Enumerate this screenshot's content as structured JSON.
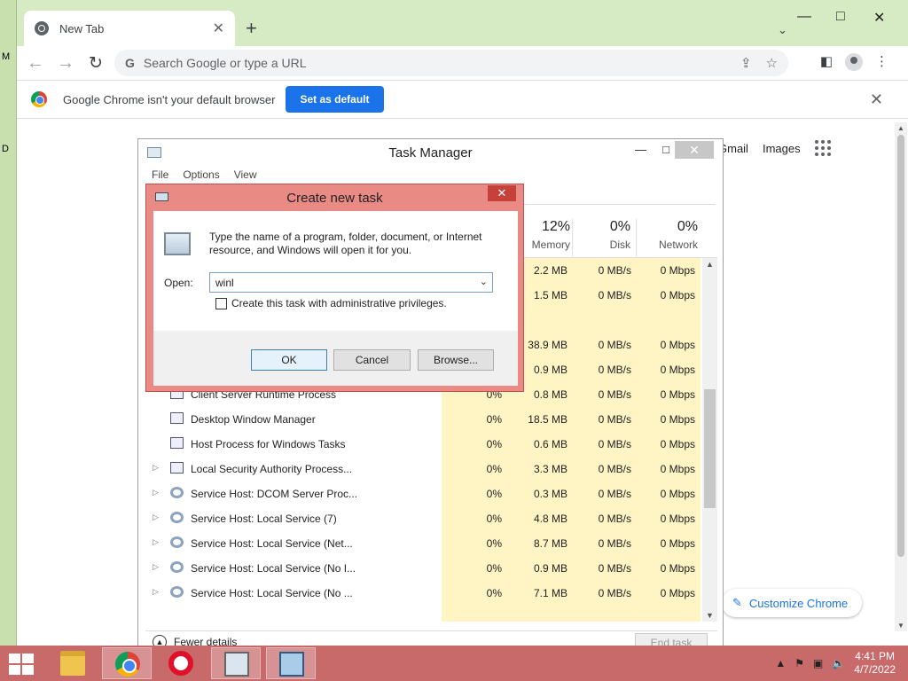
{
  "desktop": {
    "edge_letters": [
      "M",
      "D"
    ]
  },
  "chrome": {
    "tab_title": "New Tab",
    "omnibox_placeholder": "Search Google or type a URL",
    "infobar_message": "Google Chrome isn't your default browser",
    "set_default_label": "Set as default",
    "links": {
      "gmail": "Gmail",
      "images": "Images"
    },
    "customize_label": "Customize Chrome"
  },
  "task_manager": {
    "title": "Task Manager",
    "menu": [
      "File",
      "Options",
      "View"
    ],
    "columns": [
      {
        "pct": "12%",
        "label": "Memory"
      },
      {
        "pct": "0%",
        "label": "Disk"
      },
      {
        "pct": "0%",
        "label": "Network"
      }
    ],
    "rows": [
      {
        "name": "",
        "cpu": "",
        "memory": "2.2 MB",
        "disk": "0 MB/s",
        "network": "0 Mbps",
        "expandable": false,
        "icon": "window"
      },
      {
        "name": "",
        "cpu": "",
        "memory": "1.5 MB",
        "disk": "0 MB/s",
        "network": "0 Mbps",
        "expandable": false,
        "icon": "window"
      },
      {
        "name": "",
        "cpu": "",
        "memory": "",
        "disk": "",
        "network": "",
        "expandable": false,
        "icon": "none"
      },
      {
        "name": "",
        "cpu": "",
        "memory": "38.9 MB",
        "disk": "0 MB/s",
        "network": "0 Mbps",
        "expandable": false,
        "icon": "window"
      },
      {
        "name": "",
        "cpu": "",
        "memory": "0.9 MB",
        "disk": "0 MB/s",
        "network": "0 Mbps",
        "expandable": false,
        "icon": "window"
      },
      {
        "name": "Client Server Runtime Process",
        "cpu": "0%",
        "memory": "0.8 MB",
        "disk": "0 MB/s",
        "network": "0 Mbps",
        "expandable": false,
        "icon": "window"
      },
      {
        "name": "Desktop Window Manager",
        "cpu": "0%",
        "memory": "18.5 MB",
        "disk": "0 MB/s",
        "network": "0 Mbps",
        "expandable": false,
        "icon": "window"
      },
      {
        "name": "Host Process for Windows Tasks",
        "cpu": "0%",
        "memory": "0.6 MB",
        "disk": "0 MB/s",
        "network": "0 Mbps",
        "expandable": false,
        "icon": "window"
      },
      {
        "name": "Local Security Authority Process...",
        "cpu": "0%",
        "memory": "3.3 MB",
        "disk": "0 MB/s",
        "network": "0 Mbps",
        "expandable": true,
        "icon": "window"
      },
      {
        "name": "Service Host: DCOM Server Proc...",
        "cpu": "0%",
        "memory": "0.3 MB",
        "disk": "0 MB/s",
        "network": "0 Mbps",
        "expandable": true,
        "icon": "gear"
      },
      {
        "name": "Service Host: Local Service (7)",
        "cpu": "0%",
        "memory": "4.8 MB",
        "disk": "0 MB/s",
        "network": "0 Mbps",
        "expandable": true,
        "icon": "gear"
      },
      {
        "name": "Service Host: Local Service (Net...",
        "cpu": "0%",
        "memory": "8.7 MB",
        "disk": "0 MB/s",
        "network": "0 Mbps",
        "expandable": true,
        "icon": "gear"
      },
      {
        "name": "Service Host: Local Service (No I...",
        "cpu": "0%",
        "memory": "0.9 MB",
        "disk": "0 MB/s",
        "network": "0 Mbps",
        "expandable": true,
        "icon": "gear"
      },
      {
        "name": "Service Host: Local Service (No ...",
        "cpu": "0%",
        "memory": "7.1 MB",
        "disk": "0 MB/s",
        "network": "0 Mbps",
        "expandable": true,
        "icon": "gear"
      }
    ],
    "fewer_details_label": "Fewer details",
    "end_task_label": "End task"
  },
  "dialog": {
    "title": "Create new task",
    "description": "Type the name of a program, folder, document, or Internet resource, and Windows will open it for you.",
    "open_label": "Open:",
    "open_value": "winl",
    "admin_label": "Create this task with administrative privileges.",
    "admin_checked": false,
    "ok_label": "OK",
    "cancel_label": "Cancel",
    "browse_label": "Browse..."
  },
  "taskbar": {
    "apps": [
      "file-explorer",
      "google-chrome",
      "opera",
      "task-manager",
      "run-dialog"
    ],
    "active_apps": [
      "google-chrome",
      "task-manager",
      "run-dialog"
    ],
    "time": "4:41 PM",
    "date": "4/7/2022"
  },
  "colors": {
    "desktop_green": "#c7e0ae",
    "chrome_tabstrip": "#d6ebc3",
    "chrome_blue": "#1a73e8",
    "dialog_frame": "#e98a85",
    "dialog_close": "#c7413b",
    "taskbar": "#c8696a",
    "tm_highlight_column": "#fff4c4"
  }
}
